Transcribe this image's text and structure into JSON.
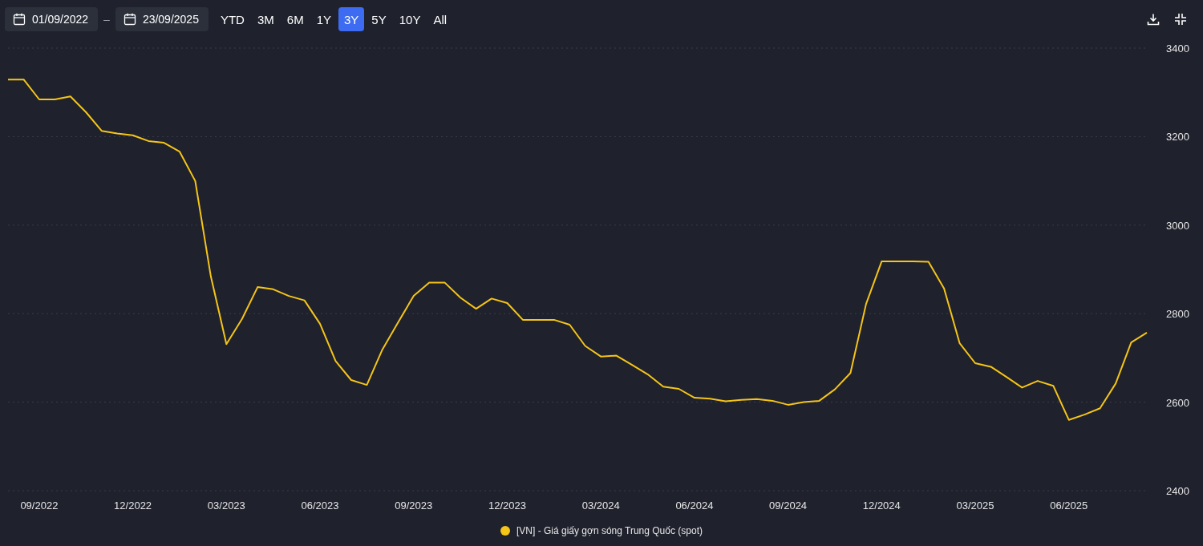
{
  "toolbar": {
    "start_date": "01/09/2022",
    "separator": "–",
    "end_date": "23/09/2025",
    "ranges": [
      {
        "label": "YTD",
        "selected": false
      },
      {
        "label": "3M",
        "selected": false
      },
      {
        "label": "6M",
        "selected": false
      },
      {
        "label": "1Y",
        "selected": false
      },
      {
        "label": "3Y",
        "selected": true
      },
      {
        "label": "5Y",
        "selected": false
      },
      {
        "label": "10Y",
        "selected": false
      },
      {
        "label": "All",
        "selected": false
      }
    ]
  },
  "chart": {
    "chart_data": {
      "type": "line",
      "grid": true,
      "ylim": [
        2400,
        3400
      ],
      "yticks": [
        2400,
        2600,
        2800,
        3000,
        3200,
        3400
      ],
      "categories": [
        null,
        null,
        "09/2022",
        null,
        null,
        null,
        null,
        null,
        "12/2022",
        null,
        null,
        null,
        null,
        null,
        "03/2023",
        null,
        null,
        null,
        null,
        null,
        "06/2023",
        null,
        null,
        null,
        null,
        null,
        "09/2023",
        null,
        null,
        null,
        null,
        null,
        "12/2023",
        null,
        null,
        null,
        null,
        null,
        "03/2024",
        null,
        null,
        null,
        null,
        null,
        "06/2024",
        null,
        null,
        null,
        null,
        null,
        "09/2024",
        null,
        null,
        null,
        null,
        null,
        "12/2024",
        null,
        null,
        null,
        null,
        null,
        "03/2025",
        null,
        null,
        null,
        null,
        null,
        "06/2025",
        null,
        null,
        null,
        null,
        null
      ],
      "series": [
        {
          "name": "[VN] - Giá giấy gợn sóng Trung Quốc (spot)",
          "color": "#f5c518",
          "values": [
            3329,
            3329,
            3284,
            3284,
            3291,
            3255,
            3213,
            3207,
            3203,
            3190,
            3186,
            3166,
            3100,
            2884,
            2731,
            2788,
            2860,
            2855,
            2840,
            2830,
            2777,
            2693,
            2650,
            2639,
            2719,
            2780,
            2840,
            2870,
            2870,
            2836,
            2811,
            2834,
            2824,
            2786,
            2786,
            2786,
            2775,
            2727,
            2703,
            2705,
            2684,
            2663,
            2635,
            2630,
            2610,
            2608,
            2602,
            2605,
            2607,
            2603,
            2594,
            2600,
            2603,
            2629,
            2666,
            2822,
            2918,
            2918,
            2918,
            2917,
            2857,
            2733,
            2688,
            2680,
            2657,
            2633,
            2648,
            2637,
            2560,
            2572,
            2586,
            2642,
            2735,
            2757
          ]
        }
      ]
    }
  }
}
